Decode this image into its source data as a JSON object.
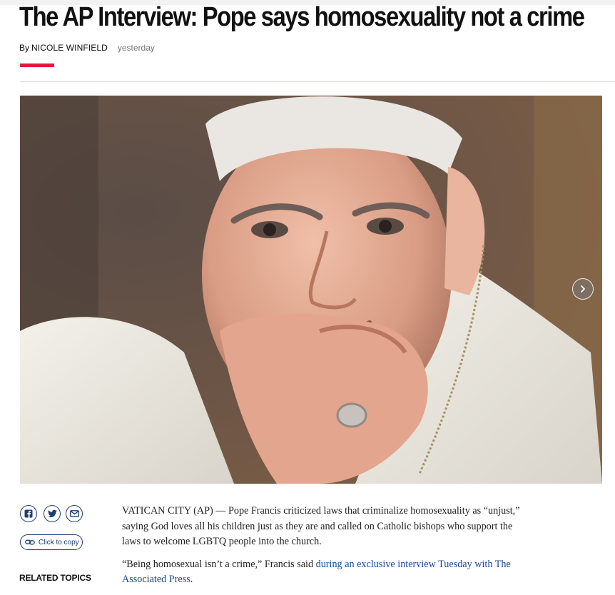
{
  "headline": "The AP Interview: Pope says homosexuality not a crime",
  "byline": {
    "prefix": "By",
    "author": "NICOLE WINFIELD",
    "time": "yesterday"
  },
  "colors": {
    "accent": "#e5173f",
    "link": "#1a4b8c",
    "icon": "#1f3f73"
  },
  "gallery": {
    "image_icon": "photo-of-pope-francis",
    "next_icon": "chevron-right-icon"
  },
  "share": {
    "icons": [
      "facebook-icon",
      "twitter-icon",
      "email-icon"
    ],
    "copy_label": "Click to copy"
  },
  "related_topics_label": "RELATED TOPICS",
  "article": {
    "p1": "VATICAN CITY (AP) — Pope Francis criticized laws that criminalize homosexuality as “unjust,” saying God loves all his children just as they are and called on Catholic bishops who support the laws to welcome LGBTQ people into the church.",
    "p2_before": "“Being homosexual isn’t a crime,” Francis said ",
    "p2_link": "during an exclusive interview Tuesday with The Associated Press",
    "p2_after": "."
  }
}
